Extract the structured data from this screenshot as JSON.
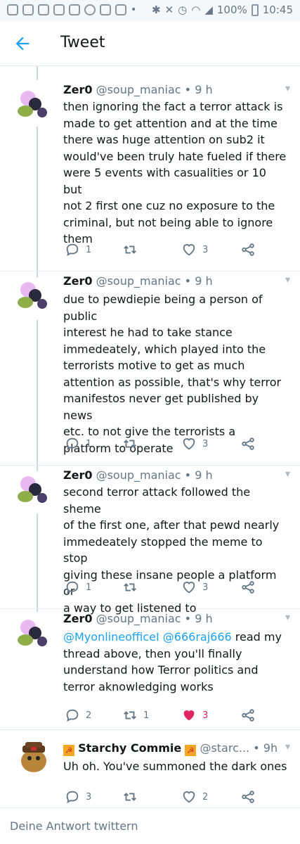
{
  "status_bar": {
    "battery": "100%",
    "time": "10:45"
  },
  "header": {
    "title": "Tweet"
  },
  "tweets": [
    {
      "name": "Zer0",
      "handle": "@soup_maniac",
      "time": "• 9 h",
      "lines": [
        "then ignoring the fact a terror attack is",
        "made to get attention and at the time",
        "there was huge attention on sub2 it",
        "would've been truly hate fueled if there",
        "were 5 events with casualities or 10 but",
        "not 2 first one cuz no exposure to the",
        "criminal, but not being able to ignore",
        "them"
      ],
      "replies": "1",
      "retweets": "",
      "likes": "3",
      "liked": false
    },
    {
      "name": "Zer0",
      "handle": "@soup_maniac",
      "time": "• 9 h",
      "lines": [
        "due to pewdiepie being a person of public",
        "interest he had to take stance",
        "immedeately, which played into the",
        "terrorists motive to get as much",
        "attention as possible, that's why terror",
        "manifestos never get published by news",
        "etc. to not give the terrorists a",
        "platform to operate"
      ],
      "replies": "1",
      "retweets": "",
      "likes": "3",
      "liked": false
    },
    {
      "name": "Zer0",
      "handle": "@soup_maniac",
      "time": "• 9 h",
      "lines": [
        "second terror attack followed the sheme",
        "of the first one, after that pewd nearly",
        "immedeately stopped the meme to stop",
        "giving these insane people a platform or",
        "a way to get listened to"
      ],
      "replies": "1",
      "retweets": "",
      "likes": "3",
      "liked": false
    },
    {
      "name": "Zer0",
      "handle": "@soup_maniac",
      "time": "• 9 h",
      "mention1": "@MyonlineofficeI",
      "mention2": "@666raj666",
      "line1_rest": " read my",
      "lines": [
        "thread above, then you'll finally",
        "understand how Terror politics and",
        "terror aknowledging works"
      ],
      "replies": "2",
      "retweets": "1",
      "likes": "3",
      "liked": true
    },
    {
      "name": "Starchy Commie",
      "handle": "@starc...",
      "time": "• 9h",
      "lines": [
        "Uh oh. You've summoned the dark ones"
      ],
      "replies": "3",
      "retweets": "",
      "likes": "2",
      "liked": false
    }
  ],
  "reply_bar": {
    "placeholder": "Deine Antwort twittern"
  },
  "colors": {
    "accent": "#1da1f2",
    "like_active": "#e0245e",
    "muted": "#657786"
  }
}
